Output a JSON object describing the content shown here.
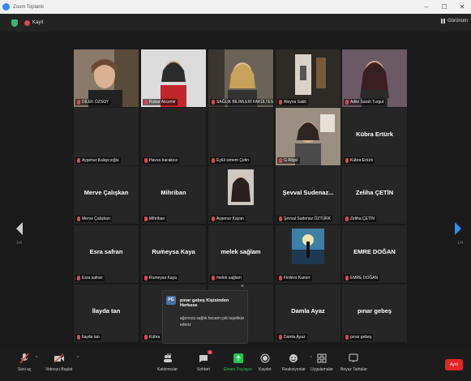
{
  "window": {
    "title": "Zoom Toplantı",
    "controls": [
      "–",
      "☐",
      "✕"
    ]
  },
  "topbar": {
    "recording_label": "Kayıt",
    "view_label": "Görünüm"
  },
  "colors": {
    "accent": "#2d8cff",
    "muted_mic": "#e0464a",
    "active_speaker": "#c9e67a",
    "end": "#e02828"
  },
  "participants": [
    {
      "label": "DİLEK ÖZSOY",
      "big": "",
      "video": "woman-glasses"
    },
    {
      "label": "Rubar Akcemir",
      "big": "",
      "video": "woman-red"
    },
    {
      "label": "SAĞLIK BİLİMLERİ FAKÜLTESİ",
      "big": "",
      "video": "woman-blonde"
    },
    {
      "label": "Aleyna Sakit",
      "big": "",
      "video": "room"
    },
    {
      "label": "Adile Sarah Turgut",
      "big": "",
      "video": "woman-dark",
      "active": true
    },
    {
      "label": "Ayşenur Kalaycıoğlu",
      "big": "",
      "video": ""
    },
    {
      "label": "Havva bacaksız",
      "big": "",
      "video": ""
    },
    {
      "label": "Eylül simem Çetin",
      "big": "",
      "video": ""
    },
    {
      "label": "G Altgül",
      "big": "",
      "video": "woman-room"
    },
    {
      "label": "Kübra Ertürk",
      "big": "Kübra Ertürk",
      "video": ""
    },
    {
      "label": "Merve Çalışkan",
      "big": "Merve Çalışkan",
      "video": ""
    },
    {
      "label": "Mihriban",
      "big": "Mihriban",
      "video": ""
    },
    {
      "label": "Ayşenur Kayan",
      "big": "",
      "video": "portrait-girl"
    },
    {
      "label": "Şevval Sudenaz ÖZTÜRK",
      "big": "Şevval Sudenaz...",
      "video": ""
    },
    {
      "label": "Zeliha ÇETİN",
      "big": "Zeliha ÇETİN",
      "video": ""
    },
    {
      "label": "Esra safran",
      "big": "Esra safran",
      "video": ""
    },
    {
      "label": "Rumeysa Kaya",
      "big": "Rumeysa Kaya",
      "video": ""
    },
    {
      "label": "melek sağlam",
      "big": "melek sağlam",
      "video": ""
    },
    {
      "label": "Firdevs Kamer",
      "big": "",
      "video": "silhouette"
    },
    {
      "label": "EMRE DOĞAN",
      "big": "EMRE DOĞAN",
      "video": ""
    },
    {
      "label": "İlayda tan",
      "big": "İlayda tan",
      "video": ""
    },
    {
      "label": "Kübra",
      "big": "",
      "video": ""
    },
    {
      "label": "",
      "big": "",
      "video": ""
    },
    {
      "label": "Damla Ayaz",
      "big": "Damla Ayaz",
      "video": ""
    },
    {
      "label": "pınar gebeş",
      "big": "pınar gebeş",
      "video": ""
    }
  ],
  "pagination": {
    "left": "1/4",
    "right": "1/4"
  },
  "chat_popup": {
    "avatar": "PG",
    "from": "pınar gebeş Kişisinden Herkese",
    "message": "ağzınıza sağlık hocam çok teşekkür ederiz",
    "close": "×"
  },
  "toolbar": {
    "mute": "Sesi aç",
    "video": "Videoyu Başlat",
    "participants": "Katılımcılar",
    "participants_count": "87",
    "chat": "Sohbet",
    "chat_badge": "1",
    "share": "Ekranı Paylaşın",
    "record": "Kaydet",
    "reactions": "Reaksiyonlar",
    "apps": "Uygulamalar",
    "whiteboard": "Beyaz Tahtalar",
    "end": "Ayrıl"
  }
}
